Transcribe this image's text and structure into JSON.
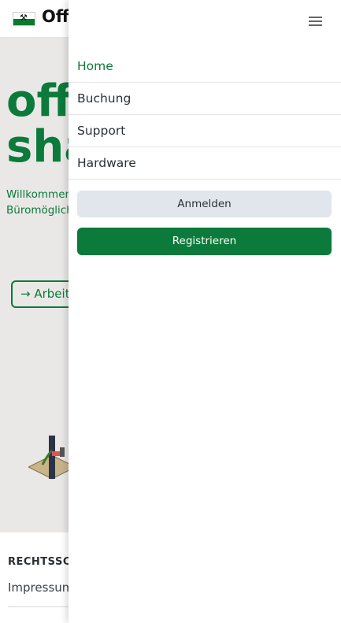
{
  "header": {
    "brand_text": "Off",
    "flag_icon": "flag-icon"
  },
  "hero": {
    "title_line1": "off",
    "title_line2": "sha",
    "text": "Willkommen die Möglichk Buchung bei Büromöglich Arbeitsumge",
    "button_label": "Arbeit",
    "button_icon": "arrow-right-icon"
  },
  "footer": {
    "heading": "RECHTSSCH",
    "link": "Impressum"
  },
  "drawer": {
    "menu_icon": "hamburger-menu-icon",
    "nav": [
      {
        "label": "Home",
        "active": true
      },
      {
        "label": "Buchung",
        "active": false
      },
      {
        "label": "Support",
        "active": false
      },
      {
        "label": "Hardware",
        "active": false
      }
    ],
    "login_label": "Anmelden",
    "register_label": "Registrieren"
  },
  "colors": {
    "brand_green": "#0b7a3a",
    "button_secondary_bg": "#e1e5ec"
  }
}
